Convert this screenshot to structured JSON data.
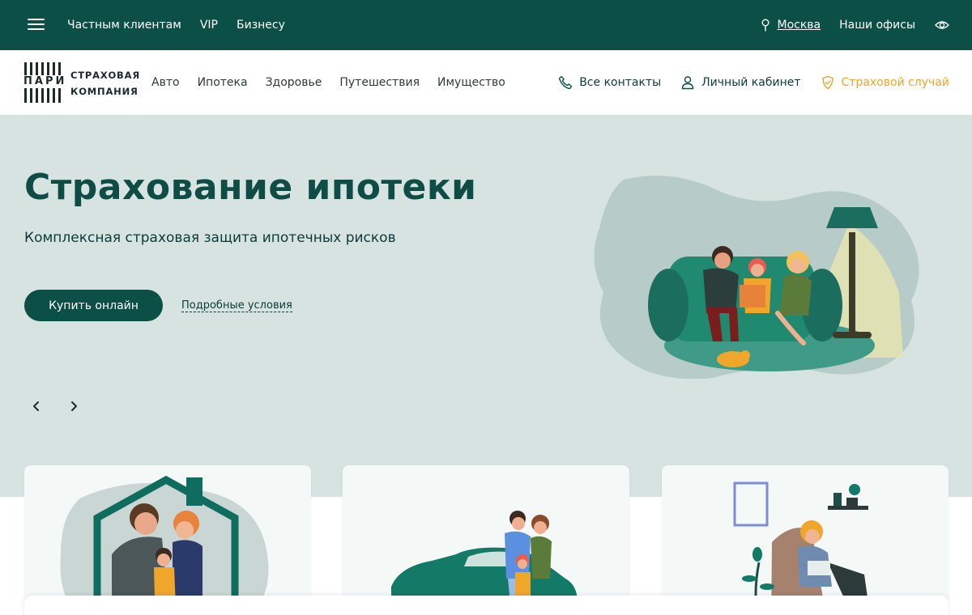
{
  "topbar": {
    "nav": [
      "Частным клиентам",
      "VIP",
      "Бизнесу"
    ],
    "city": "Москва",
    "offices": "Наши офисы"
  },
  "logo": {
    "mark": "ПАРИ",
    "line1": "СТРАХОВАЯ",
    "line2": "КОМПАНИЯ"
  },
  "mainnav": [
    "Авто",
    "Ипотека",
    "Здоровье",
    "Путешествия",
    "Имущество"
  ],
  "headright": {
    "contacts": "Все контакты",
    "cabinet": "Личный кабинет",
    "insurance_case": "Страховой случай"
  },
  "hero": {
    "title": "Страхование ипотеки",
    "subtitle": "Комплексная страховая защита ипотечных рисков",
    "buy_label": "Купить онлайн",
    "details_label": "Подробные условия"
  },
  "colors": {
    "brand_dark": "#0b4f47",
    "hero_bg": "#d7e3e1",
    "accent_orange": "#f0a52b"
  }
}
